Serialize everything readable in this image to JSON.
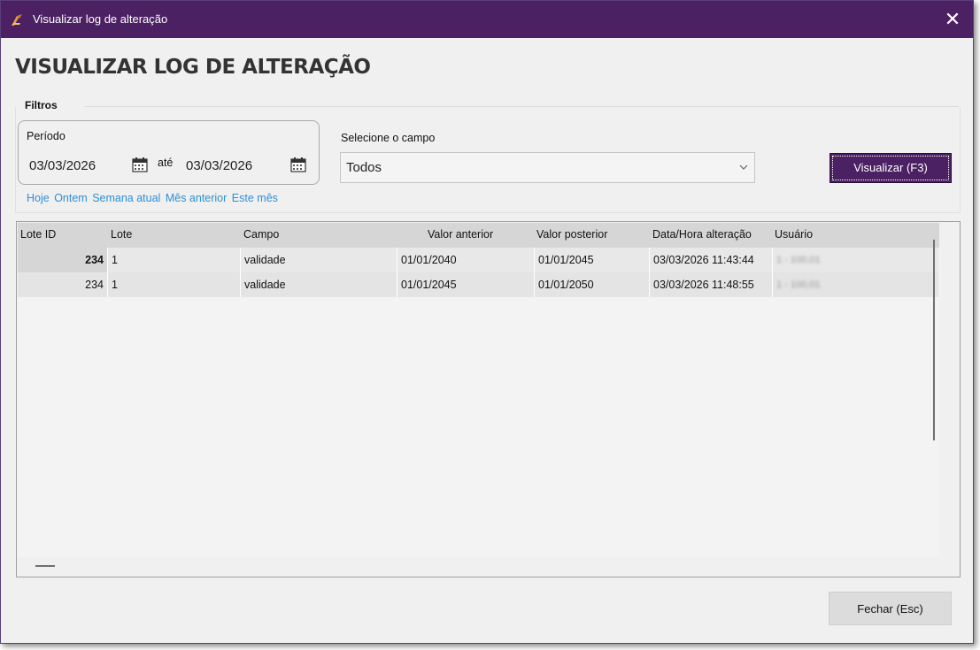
{
  "window": {
    "title": "Visualizar log de alteração",
    "close_glyph": "✕",
    "accent_color": "#4b2163"
  },
  "page": {
    "title": "VISUALIZAR LOG DE ALTERAÇÃO"
  },
  "filters": {
    "label": "Filtros",
    "period": {
      "label": "Período",
      "start": "03/03/2026",
      "separator": "até",
      "end": "03/03/2026",
      "calendar_icon": "calendar-icon"
    },
    "quick_links": [
      "Hoje",
      "Ontem",
      "Semana atual",
      "Mês anterior",
      "Este mês"
    ],
    "field": {
      "label": "Selecione o campo",
      "value": "Todos",
      "chevron_icon": "chevron-down-icon"
    },
    "view_button": "Visualizar (F3)"
  },
  "grid": {
    "columns": [
      "Lote ID",
      "Lote",
      "Campo",
      "Valor anterior",
      "Valor posterior",
      "Data/Hora alteração",
      "Usuário"
    ],
    "rows": [
      {
        "lote_id": "234",
        "lote": "1",
        "campo": "validade",
        "valor_anterior": "01/01/2040",
        "valor_posterior": "01/01/2045",
        "data_hora": "03/03/2026 11:43:44",
        "usuario": "1 - 100,01"
      },
      {
        "lote_id": "234",
        "lote": "1",
        "campo": "validade",
        "valor_anterior": "01/01/2045",
        "valor_posterior": "01/01/2050",
        "data_hora": "03/03/2026 11:48:55",
        "usuario": "1 - 100,01"
      }
    ]
  },
  "footer": {
    "close_button": "Fechar (Esc)"
  }
}
